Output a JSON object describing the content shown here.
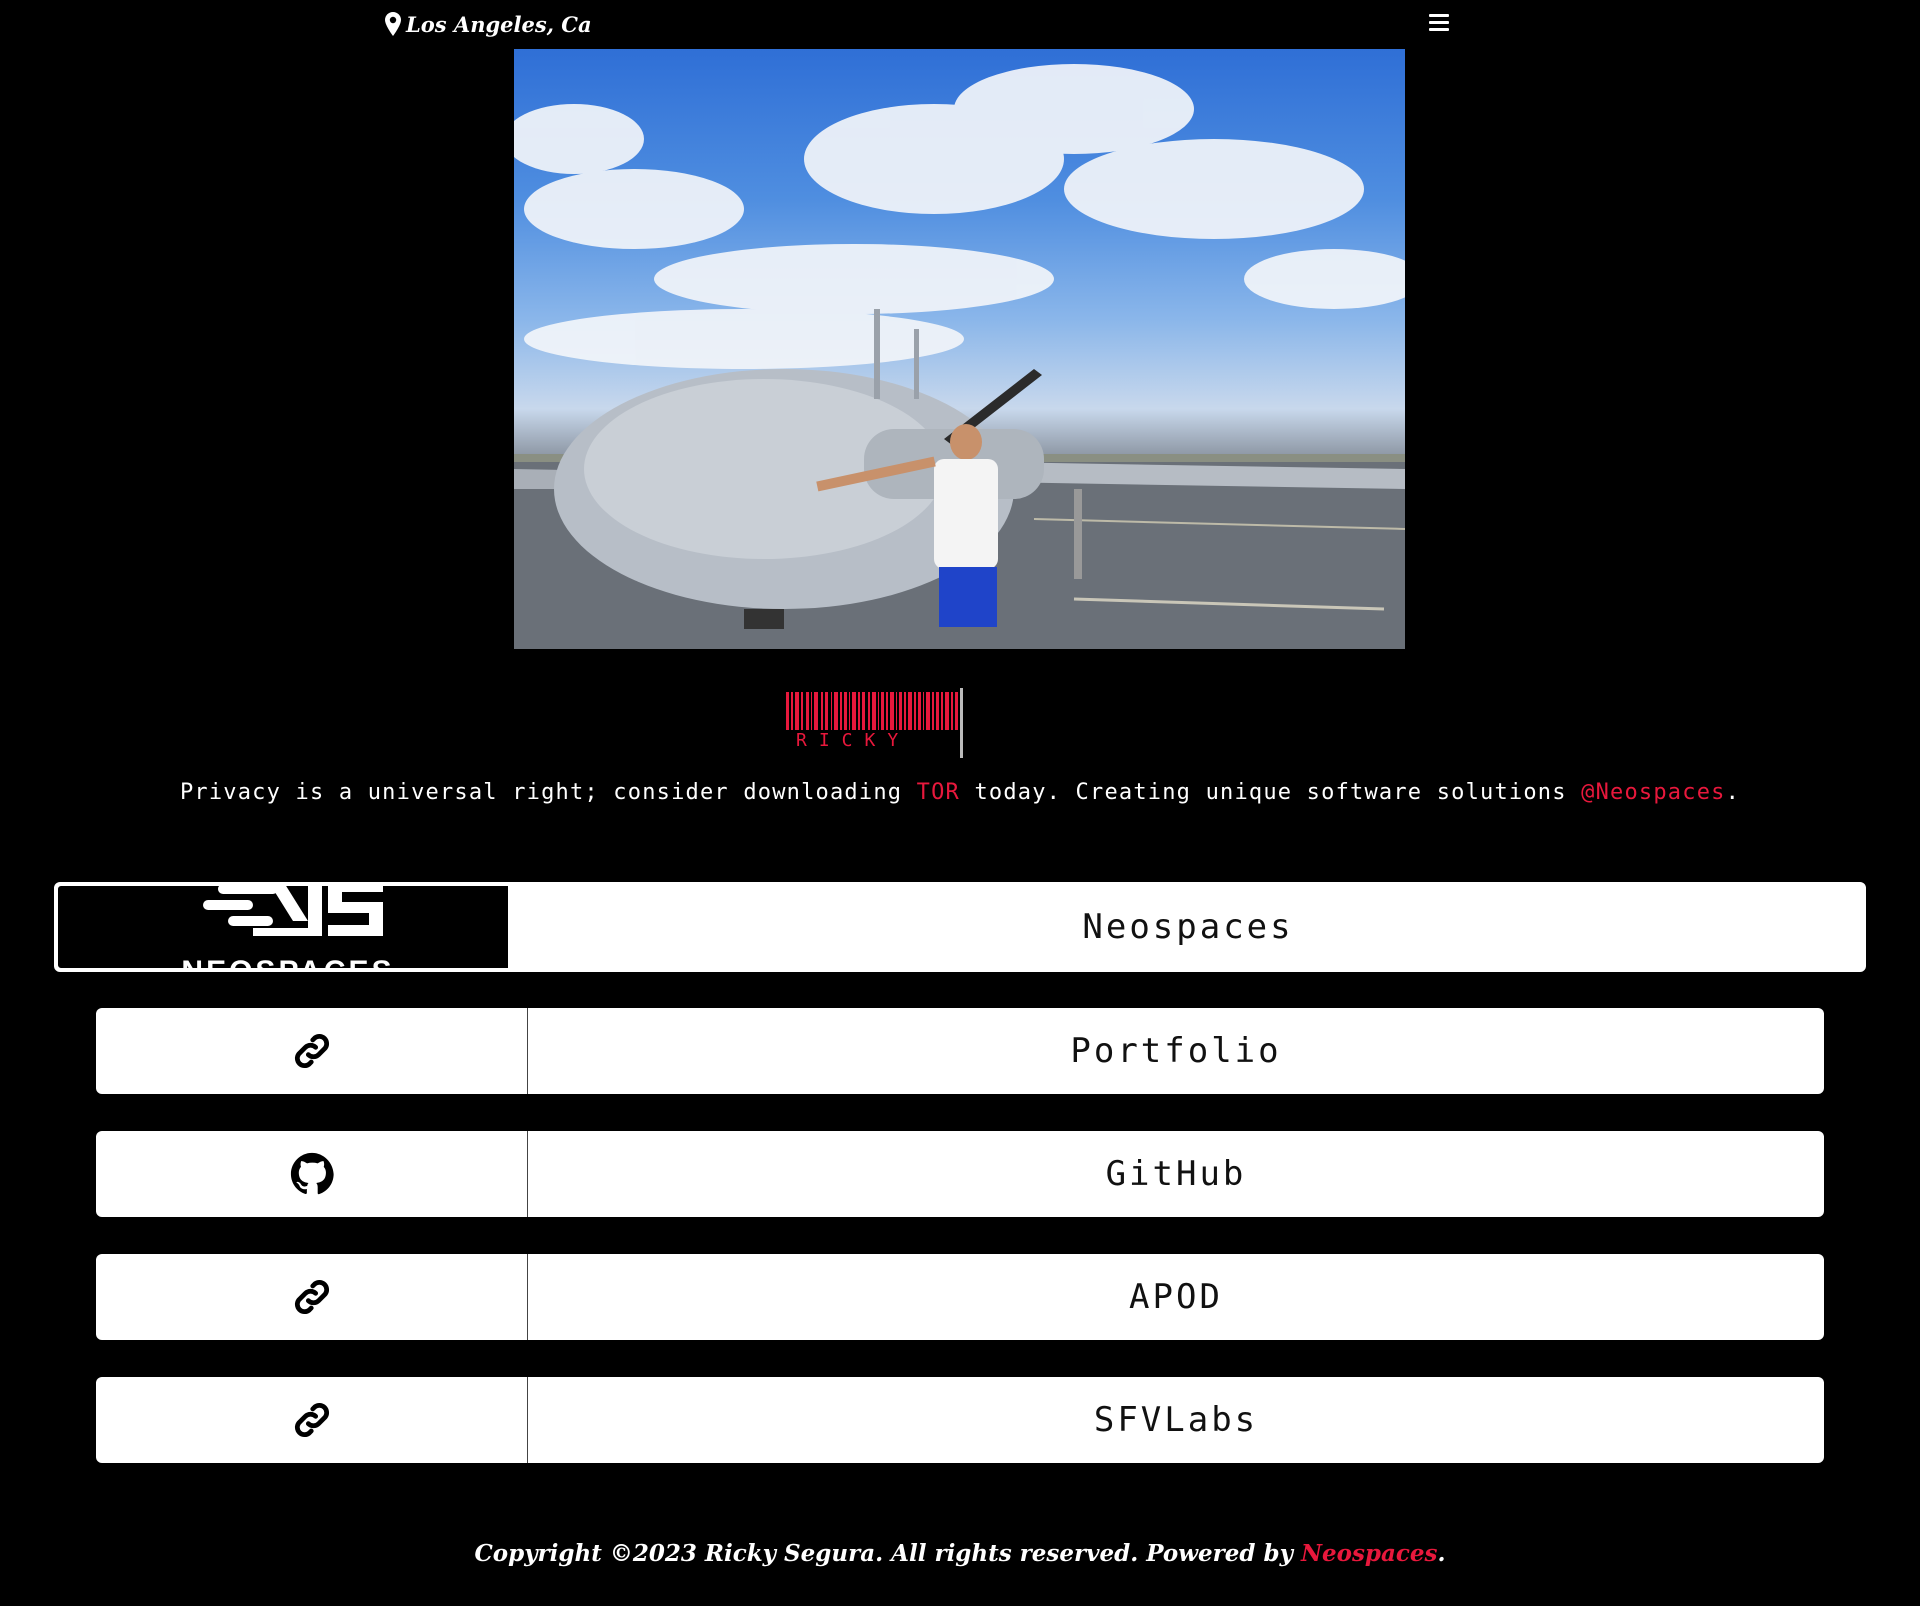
{
  "header": {
    "location": "Los Angeles, Ca",
    "location_icon": "map-pin-icon",
    "menu_icon": "hamburger-menu-icon"
  },
  "hero": {
    "image_name": "profile-photo"
  },
  "brand": {
    "barcode_text": "RICKY"
  },
  "tagline": {
    "part1": "Privacy is a universal right; consider downloading ",
    "link1": "TOR",
    "part2": " today. Creating unique software solutions ",
    "link2": "@Neospaces",
    "part3": "."
  },
  "links": [
    {
      "label": "Neospaces",
      "icon": "neospaces-logo"
    },
    {
      "label": "Portfolio",
      "icon": "link-icon"
    },
    {
      "label": "GitHub",
      "icon": "github-icon"
    },
    {
      "label": "APOD",
      "icon": "link-icon"
    },
    {
      "label": "SFVLabs",
      "icon": "link-icon"
    }
  ],
  "neo_logo_text": "NEOSPACES",
  "footer": {
    "text": "Copyright ©2023 Ricky Segura. All rights reserved. Powered by ",
    "link": "Neospaces",
    "end": "."
  },
  "colors": {
    "background": "#000000",
    "accent": "#e8183c",
    "card": "#ffffff"
  }
}
